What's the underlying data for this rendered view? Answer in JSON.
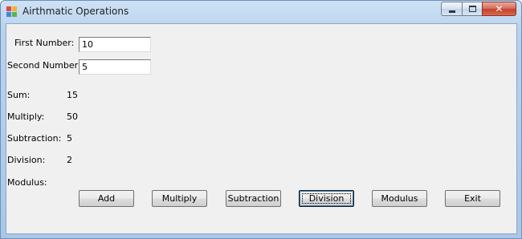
{
  "window": {
    "title": "Airthmatic Operations",
    "icon": "app-window-icon",
    "controls": {
      "minimize": "minimize-icon",
      "maximize": "maximize-icon",
      "close": "close-icon"
    }
  },
  "inputs": {
    "first_label": "First Number:",
    "first_value": "10",
    "second_label": "Second Number:",
    "second_value": "5"
  },
  "results": {
    "sum_label": "Sum:",
    "sum_value": "15",
    "multiply_label": "Multiply:",
    "multiply_value": "50",
    "subtraction_label": "Subtraction:",
    "subtraction_value": "5",
    "division_label": "Division:",
    "division_value": "2",
    "modulus_label": "Modulus:",
    "modulus_value": ""
  },
  "buttons": {
    "add": "Add",
    "multiply": "Multiply",
    "subtraction": "Subtraction",
    "division": "Division",
    "modulus": "Modulus",
    "exit": "Exit"
  },
  "colors": {
    "title_bar": "#b9d3ee",
    "form_background": "#f0f0f0",
    "close_button": "#c4412b"
  }
}
